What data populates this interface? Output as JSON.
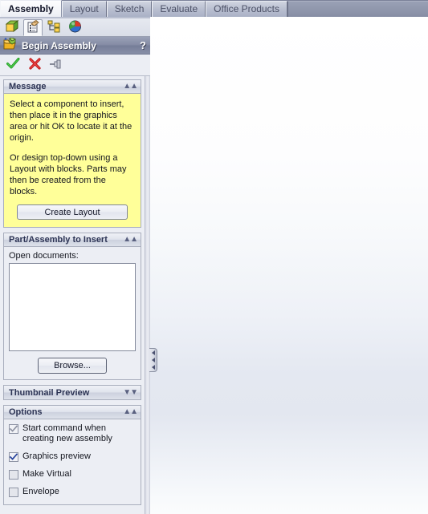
{
  "command_tabs": {
    "items": [
      {
        "label": "Assembly",
        "active": true
      },
      {
        "label": "Layout",
        "active": false
      },
      {
        "label": "Sketch",
        "active": false
      },
      {
        "label": "Evaluate",
        "active": false
      },
      {
        "label": "Office Products",
        "active": false
      }
    ]
  },
  "manager_tabs": {
    "items": [
      {
        "name": "feature-manager-tree-icon",
        "active": false
      },
      {
        "name": "property-manager-icon",
        "active": true
      },
      {
        "name": "configuration-manager-icon",
        "active": false
      },
      {
        "name": "display-manager-icon",
        "active": false
      }
    ]
  },
  "property_manager": {
    "title": "Begin Assembly",
    "help_label": "?",
    "actions": [
      {
        "name": "ok-button",
        "label": "OK"
      },
      {
        "name": "cancel-button",
        "label": "Cancel"
      },
      {
        "name": "keep-visible-pin-button",
        "label": "Keep Visible"
      }
    ]
  },
  "message_panel": {
    "title": "Message",
    "collapse_state": "expanded",
    "paragraph1": "Select a component to insert, then place it in the graphics area or hit OK to locate it at the origin.",
    "paragraph2": "Or design top-down using a Layout with blocks. Parts may then be created from the blocks.",
    "create_layout_label": "Create Layout",
    "background_color": "#ffff99"
  },
  "part_assembly_panel": {
    "title": "Part/Assembly to Insert",
    "collapse_state": "expanded",
    "open_documents_label": "Open documents:",
    "open_documents": [],
    "browse_label": "Browse..."
  },
  "thumbnail_panel": {
    "title": "Thumbnail Preview",
    "collapse_state": "collapsed"
  },
  "options_panel": {
    "title": "Options",
    "collapse_state": "expanded",
    "items": [
      {
        "label": "Start command when creating new assembly",
        "checked": true,
        "disabled": true
      },
      {
        "label": "Graphics preview",
        "checked": true,
        "disabled": false
      },
      {
        "label": "Make Virtual",
        "checked": false,
        "disabled": false
      },
      {
        "label": "Envelope",
        "checked": false,
        "disabled": false
      }
    ]
  },
  "splitter": {
    "name": "panel-splitter-handle",
    "direction": "collapse-left"
  },
  "colors": {
    "tab_bar": "#7b8199",
    "title_bar": "#848ba4",
    "panel_background": "#eceef4",
    "message_yellow": "#ffff99",
    "check_blue": "#27439c",
    "check_gray": "#8b90a0"
  }
}
